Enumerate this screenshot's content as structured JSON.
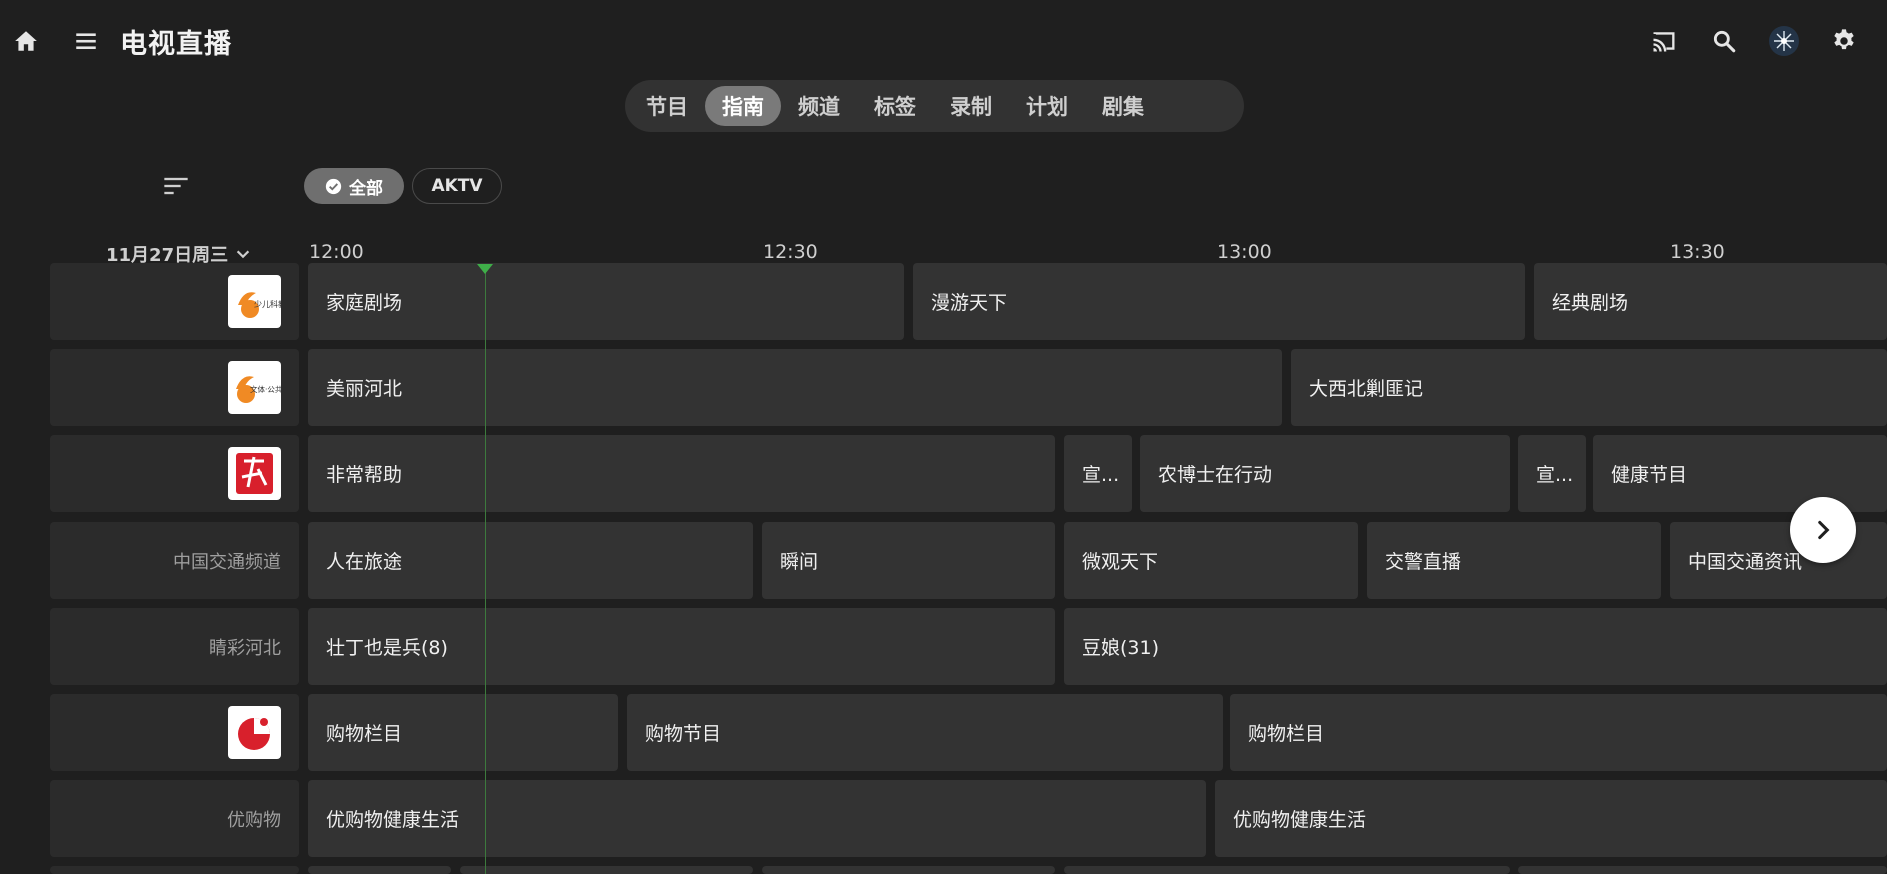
{
  "header": {
    "title": "电视直播"
  },
  "tabs": [
    "节目",
    "指南",
    "频道",
    "标签",
    "录制",
    "计划",
    "剧集"
  ],
  "filters": {
    "all": "全部",
    "aktv": "AKTV"
  },
  "guide": {
    "date": "11月27日周三",
    "times": [
      "12:00",
      "12:30",
      "13:00",
      "13:30"
    ]
  },
  "channels": [
    {
      "name": "",
      "logo_text": "少儿科教",
      "programs": [
        "家庭剧场",
        "漫游天下",
        "经典剧场"
      ]
    },
    {
      "name": "",
      "logo_text": "文体·公共",
      "programs": [
        "美丽河北",
        "大西北剿匪记"
      ]
    },
    {
      "name": "",
      "logo_text": "",
      "programs": [
        "非常帮助",
        "宣...",
        "农博士在行动",
        "宣...",
        "健康节目"
      ]
    },
    {
      "name": "中国交通频道",
      "programs": [
        "人在旅途",
        "瞬间",
        "微观天下",
        "交警直播",
        "中国交通资讯"
      ]
    },
    {
      "name": "睛彩河北",
      "programs": [
        "壮丁也是兵(8)",
        "豆娘(31)"
      ]
    },
    {
      "name": "",
      "logo_text": "",
      "programs": [
        "购物栏目",
        "购物节目",
        "购物栏目"
      ]
    },
    {
      "name": "优购物",
      "programs": [
        "优购物健康生活",
        "优购物健康生活"
      ]
    }
  ],
  "colors": {
    "accent_now": "#3fae49",
    "active_tab": "#7a7a7a",
    "program_bg": "#333333"
  },
  "icons": [
    "home-icon",
    "menu-icon",
    "cast-icon",
    "search-icon",
    "avatar",
    "settings-icon",
    "sort-icon",
    "check-circle-icon",
    "chevron-down-icon",
    "chevron-right-icon"
  ]
}
